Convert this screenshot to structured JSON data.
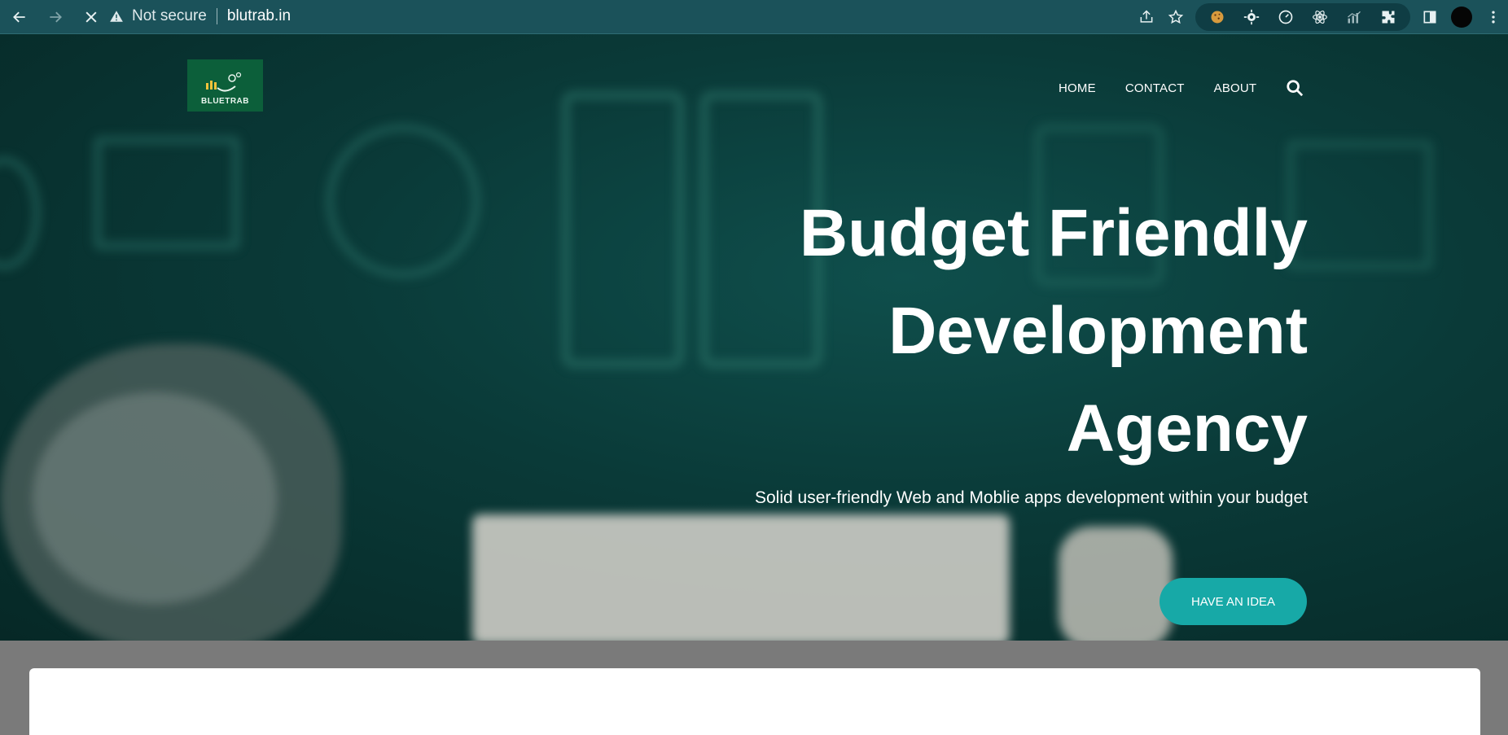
{
  "browser": {
    "security_label": "Not secure",
    "url": "blutrab.in",
    "theme_color": "#1b525a"
  },
  "site": {
    "logo_text": "BLUETRAB",
    "nav": [
      {
        "label": "HOME"
      },
      {
        "label": "CONTACT"
      },
      {
        "label": "ABOUT"
      }
    ]
  },
  "hero": {
    "title_lines": [
      "Budget Friendly",
      "Development",
      "Agency"
    ],
    "subtitle": "Solid user-friendly Web and Moblie apps development within your budget",
    "cta_label": "HAVE AN IDEA",
    "accent_color": "#17a9a7"
  }
}
